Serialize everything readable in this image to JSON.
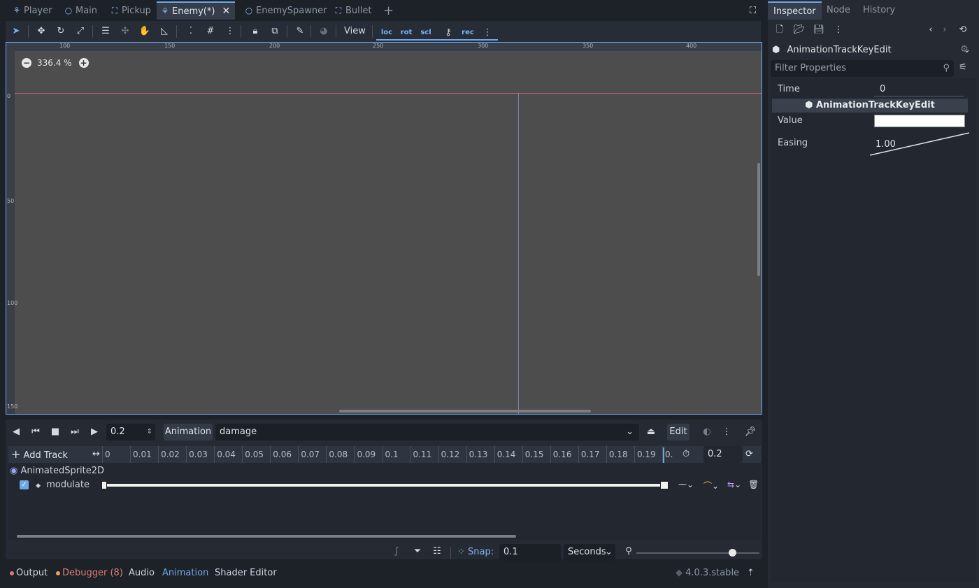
{
  "tabs": [
    {
      "label": "Player",
      "icon": "node-2d-icon"
    },
    {
      "label": "Main",
      "icon": "node-icon"
    },
    {
      "label": "Pickup",
      "icon": "area-icon"
    },
    {
      "label": "Enemy(*)",
      "icon": "node-2d-icon",
      "active": true
    },
    {
      "label": "EnemySpawner",
      "icon": "node-icon"
    },
    {
      "label": "Bullet",
      "icon": "area-icon"
    }
  ],
  "toolbar": {
    "view_label": "View",
    "loc": "loc",
    "rot": "rot",
    "scl": "scl",
    "rec": "rec"
  },
  "viewport": {
    "zoom_label": "336.4 %",
    "ruler_top": [
      "100",
      "150",
      "200",
      "250",
      "300",
      "350",
      "400"
    ],
    "ruler_left": [
      "0",
      "50",
      "100",
      "150"
    ]
  },
  "animation": {
    "time_value": "0.2",
    "animation_label": "Animation",
    "animation_name": "damage",
    "edit_label": "Edit",
    "add_track_label": "Add Track",
    "ticks": [
      "0",
      "0.01",
      "0.02",
      "0.03",
      "0.04",
      "0.05",
      "0.06",
      "0.07",
      "0.08",
      "0.09",
      "0.1",
      "0.11",
      "0.12",
      "0.13",
      "0.14",
      "0.15",
      "0.16",
      "0.17",
      "0.18",
      "0.19",
      "0."
    ],
    "length_value": "0.2",
    "node_name": "AnimatedSprite2D",
    "track_name": "modulate",
    "snap_label": "Snap:",
    "snap_value": "0.1",
    "snap_unit": "Seconds"
  },
  "dock": {
    "output": "Output",
    "debugger": "Debugger (8)",
    "audio": "Audio",
    "animation": "Animation",
    "shader_editor": "Shader Editor",
    "version": "4.0.3.stable"
  },
  "inspector": {
    "tabs": [
      "Inspector",
      "Node",
      "History"
    ],
    "object_name": "AnimationTrackKeyEdit",
    "filter_placeholder": "Filter Properties",
    "time_label": "Time",
    "time_value": "0",
    "section_title": "AnimationTrackKeyEdit",
    "value_label": "Value",
    "easing_label": "Easing",
    "easing_value": "1.00"
  },
  "colors": {
    "accent": "#6ea7e8",
    "debugger": "#e07a6e",
    "animation_active": "#6ea7e8"
  }
}
